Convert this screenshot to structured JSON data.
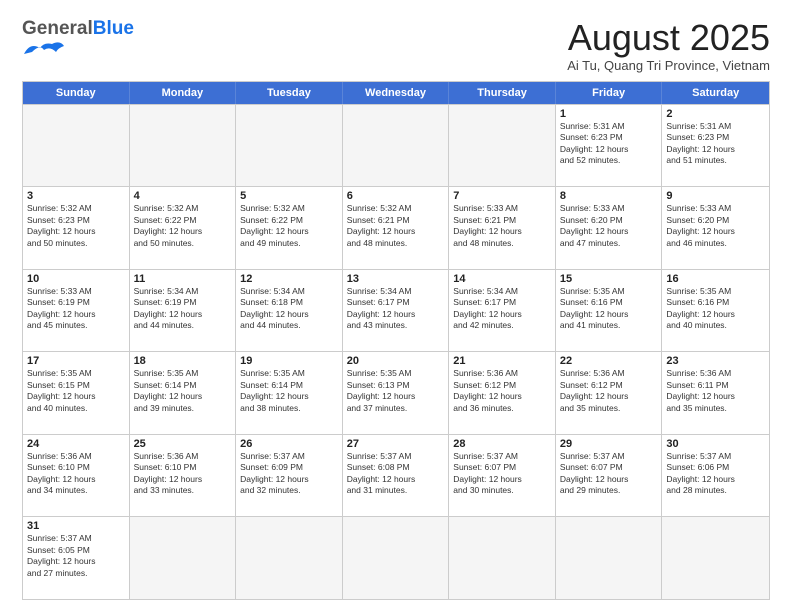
{
  "header": {
    "logo_general": "General",
    "logo_blue": "Blue",
    "month_title": "August 2025",
    "location": "Ai Tu, Quang Tri Province, Vietnam"
  },
  "days_of_week": [
    "Sunday",
    "Monday",
    "Tuesday",
    "Wednesday",
    "Thursday",
    "Friday",
    "Saturday"
  ],
  "weeks": [
    [
      {
        "num": "",
        "info": ""
      },
      {
        "num": "",
        "info": ""
      },
      {
        "num": "",
        "info": ""
      },
      {
        "num": "",
        "info": ""
      },
      {
        "num": "",
        "info": ""
      },
      {
        "num": "1",
        "info": "Sunrise: 5:31 AM\nSunset: 6:23 PM\nDaylight: 12 hours\nand 52 minutes."
      },
      {
        "num": "2",
        "info": "Sunrise: 5:31 AM\nSunset: 6:23 PM\nDaylight: 12 hours\nand 51 minutes."
      }
    ],
    [
      {
        "num": "3",
        "info": "Sunrise: 5:32 AM\nSunset: 6:23 PM\nDaylight: 12 hours\nand 50 minutes."
      },
      {
        "num": "4",
        "info": "Sunrise: 5:32 AM\nSunset: 6:22 PM\nDaylight: 12 hours\nand 50 minutes."
      },
      {
        "num": "5",
        "info": "Sunrise: 5:32 AM\nSunset: 6:22 PM\nDaylight: 12 hours\nand 49 minutes."
      },
      {
        "num": "6",
        "info": "Sunrise: 5:32 AM\nSunset: 6:21 PM\nDaylight: 12 hours\nand 48 minutes."
      },
      {
        "num": "7",
        "info": "Sunrise: 5:33 AM\nSunset: 6:21 PM\nDaylight: 12 hours\nand 48 minutes."
      },
      {
        "num": "8",
        "info": "Sunrise: 5:33 AM\nSunset: 6:20 PM\nDaylight: 12 hours\nand 47 minutes."
      },
      {
        "num": "9",
        "info": "Sunrise: 5:33 AM\nSunset: 6:20 PM\nDaylight: 12 hours\nand 46 minutes."
      }
    ],
    [
      {
        "num": "10",
        "info": "Sunrise: 5:33 AM\nSunset: 6:19 PM\nDaylight: 12 hours\nand 45 minutes."
      },
      {
        "num": "11",
        "info": "Sunrise: 5:34 AM\nSunset: 6:19 PM\nDaylight: 12 hours\nand 44 minutes."
      },
      {
        "num": "12",
        "info": "Sunrise: 5:34 AM\nSunset: 6:18 PM\nDaylight: 12 hours\nand 44 minutes."
      },
      {
        "num": "13",
        "info": "Sunrise: 5:34 AM\nSunset: 6:17 PM\nDaylight: 12 hours\nand 43 minutes."
      },
      {
        "num": "14",
        "info": "Sunrise: 5:34 AM\nSunset: 6:17 PM\nDaylight: 12 hours\nand 42 minutes."
      },
      {
        "num": "15",
        "info": "Sunrise: 5:35 AM\nSunset: 6:16 PM\nDaylight: 12 hours\nand 41 minutes."
      },
      {
        "num": "16",
        "info": "Sunrise: 5:35 AM\nSunset: 6:16 PM\nDaylight: 12 hours\nand 40 minutes."
      }
    ],
    [
      {
        "num": "17",
        "info": "Sunrise: 5:35 AM\nSunset: 6:15 PM\nDaylight: 12 hours\nand 40 minutes."
      },
      {
        "num": "18",
        "info": "Sunrise: 5:35 AM\nSunset: 6:14 PM\nDaylight: 12 hours\nand 39 minutes."
      },
      {
        "num": "19",
        "info": "Sunrise: 5:35 AM\nSunset: 6:14 PM\nDaylight: 12 hours\nand 38 minutes."
      },
      {
        "num": "20",
        "info": "Sunrise: 5:35 AM\nSunset: 6:13 PM\nDaylight: 12 hours\nand 37 minutes."
      },
      {
        "num": "21",
        "info": "Sunrise: 5:36 AM\nSunset: 6:12 PM\nDaylight: 12 hours\nand 36 minutes."
      },
      {
        "num": "22",
        "info": "Sunrise: 5:36 AM\nSunset: 6:12 PM\nDaylight: 12 hours\nand 35 minutes."
      },
      {
        "num": "23",
        "info": "Sunrise: 5:36 AM\nSunset: 6:11 PM\nDaylight: 12 hours\nand 35 minutes."
      }
    ],
    [
      {
        "num": "24",
        "info": "Sunrise: 5:36 AM\nSunset: 6:10 PM\nDaylight: 12 hours\nand 34 minutes."
      },
      {
        "num": "25",
        "info": "Sunrise: 5:36 AM\nSunset: 6:10 PM\nDaylight: 12 hours\nand 33 minutes."
      },
      {
        "num": "26",
        "info": "Sunrise: 5:37 AM\nSunset: 6:09 PM\nDaylight: 12 hours\nand 32 minutes."
      },
      {
        "num": "27",
        "info": "Sunrise: 5:37 AM\nSunset: 6:08 PM\nDaylight: 12 hours\nand 31 minutes."
      },
      {
        "num": "28",
        "info": "Sunrise: 5:37 AM\nSunset: 6:07 PM\nDaylight: 12 hours\nand 30 minutes."
      },
      {
        "num": "29",
        "info": "Sunrise: 5:37 AM\nSunset: 6:07 PM\nDaylight: 12 hours\nand 29 minutes."
      },
      {
        "num": "30",
        "info": "Sunrise: 5:37 AM\nSunset: 6:06 PM\nDaylight: 12 hours\nand 28 minutes."
      }
    ],
    [
      {
        "num": "31",
        "info": "Sunrise: 5:37 AM\nSunset: 6:05 PM\nDaylight: 12 hours\nand 27 minutes."
      },
      {
        "num": "",
        "info": ""
      },
      {
        "num": "",
        "info": ""
      },
      {
        "num": "",
        "info": ""
      },
      {
        "num": "",
        "info": ""
      },
      {
        "num": "",
        "info": ""
      },
      {
        "num": "",
        "info": ""
      }
    ]
  ]
}
